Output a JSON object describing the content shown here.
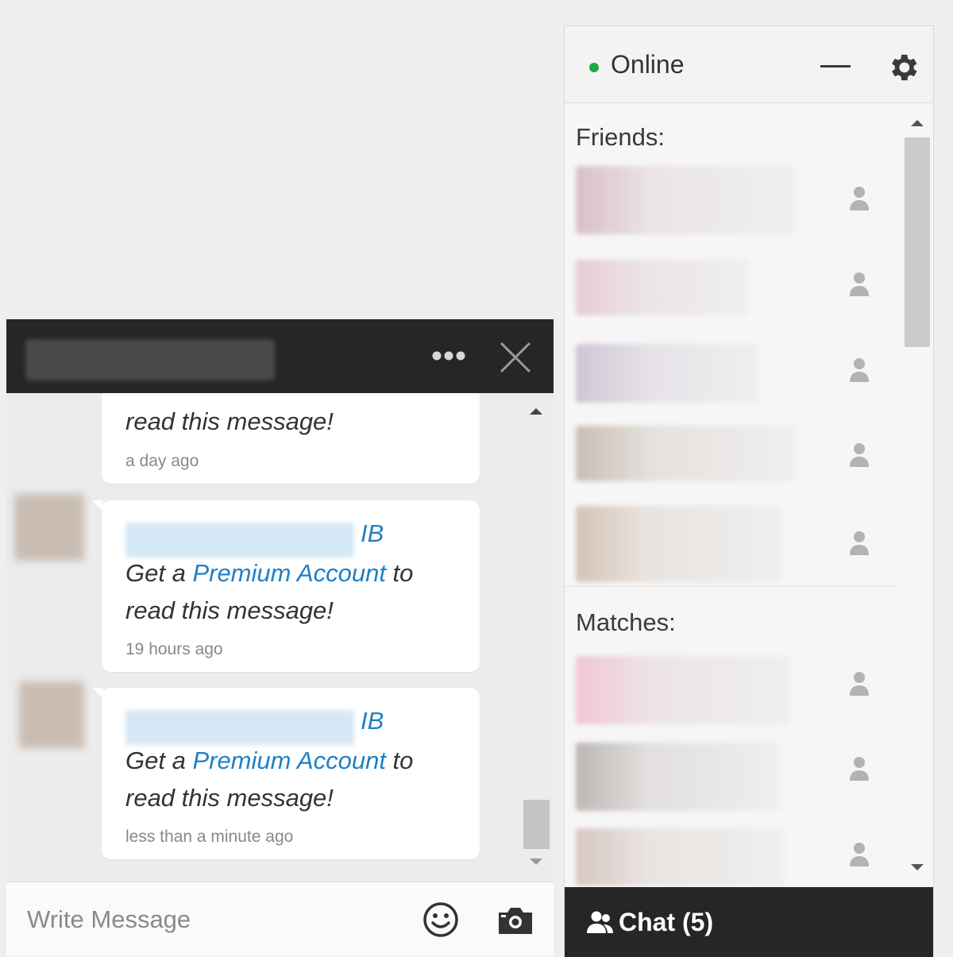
{
  "contacts_panel": {
    "status": {
      "label": "Online",
      "color": "#1aa843"
    },
    "minimize_icon": "minimize-icon",
    "settings_icon": "gear-icon",
    "friends_heading": "Friends:",
    "matches_heading": "Matches:",
    "friends": [
      {
        "name_hidden": true
      },
      {
        "name_hidden": true
      },
      {
        "name_hidden": true
      },
      {
        "name_hidden": true
      },
      {
        "name_hidden": true
      }
    ],
    "matches": [
      {
        "name_hidden": true
      },
      {
        "name_hidden": true
      },
      {
        "name_hidden": true
      }
    ],
    "chat_bar": {
      "icon": "users-icon",
      "label": "Chat (5)"
    }
  },
  "chat_window": {
    "recipient_hidden": true,
    "options_icon": "more-dots-icon",
    "close_icon": "close-icon",
    "messages": [
      {
        "partial": true,
        "line2": "read this message!",
        "time": "a day ago"
      },
      {
        "sender_suffix": "IB",
        "line1_prefix": "Get a ",
        "line1_link": "Premium Account",
        "line1_suffix": " to",
        "line2": "read this message!",
        "time": "19 hours ago"
      },
      {
        "sender_suffix": "IB",
        "line1_prefix": "Get a ",
        "line1_link": "Premium Account",
        "line1_suffix": " to",
        "line2": "read this message!",
        "time": "less than a minute ago"
      }
    ],
    "composer": {
      "placeholder": "Write Message",
      "emoji_icon": "smiley-icon",
      "camera_icon": "camera-icon"
    }
  },
  "colors": {
    "link": "#1f7fc6",
    "dark_bar": "#262626",
    "background": "#efefef"
  }
}
